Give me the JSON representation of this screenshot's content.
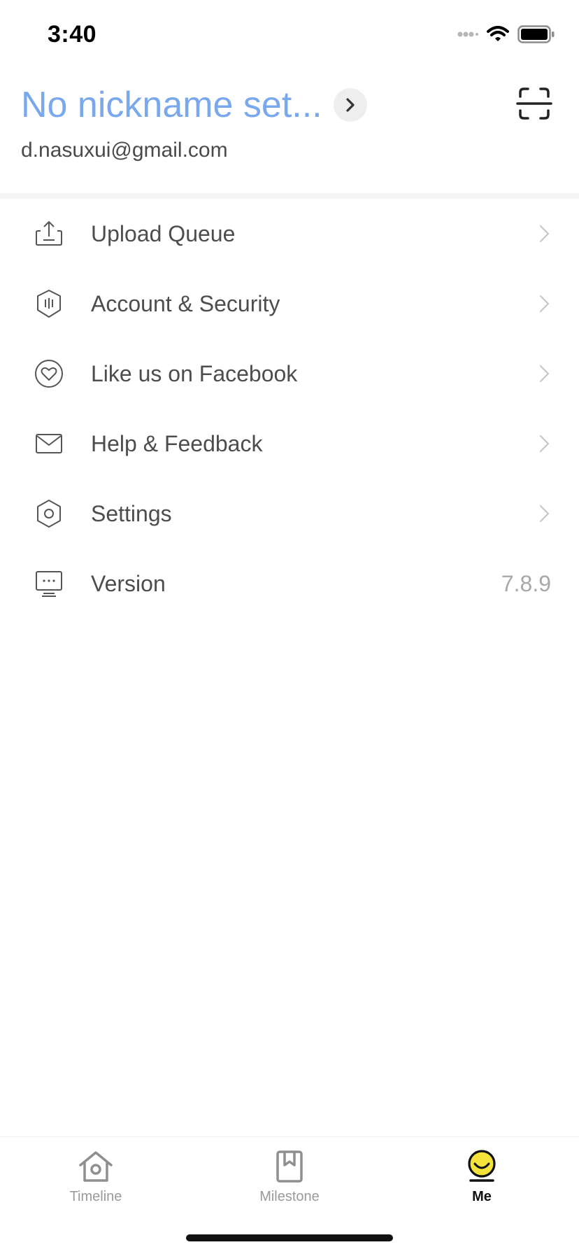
{
  "status_bar": {
    "time": "3:40",
    "icons": [
      "signal-icon",
      "wifi-icon",
      "battery-icon"
    ]
  },
  "profile": {
    "nickname": "No nickname set...",
    "email": "d.nasuxui@gmail.com",
    "nickname_color": "#7aa8ec"
  },
  "menu": {
    "items": [
      {
        "label": "Upload Queue",
        "icon": "upload-icon"
      },
      {
        "label": "Account & Security",
        "icon": "shield-icon"
      },
      {
        "label": "Like us on Facebook",
        "icon": "heart-icon"
      },
      {
        "label": "Help & Feedback",
        "icon": "mail-icon"
      },
      {
        "label": "Settings",
        "icon": "gear-icon"
      },
      {
        "label": "Version",
        "icon": "monitor-icon",
        "value": "7.8.9"
      }
    ]
  },
  "tab_bar": {
    "tabs": [
      {
        "label": "Timeline",
        "icon": "home-icon",
        "active": false
      },
      {
        "label": "Milestone",
        "icon": "bookmark-icon",
        "active": false
      },
      {
        "label": "Me",
        "icon": "smiley-icon",
        "active": true
      }
    ],
    "accent_color": "#f5e23a"
  }
}
